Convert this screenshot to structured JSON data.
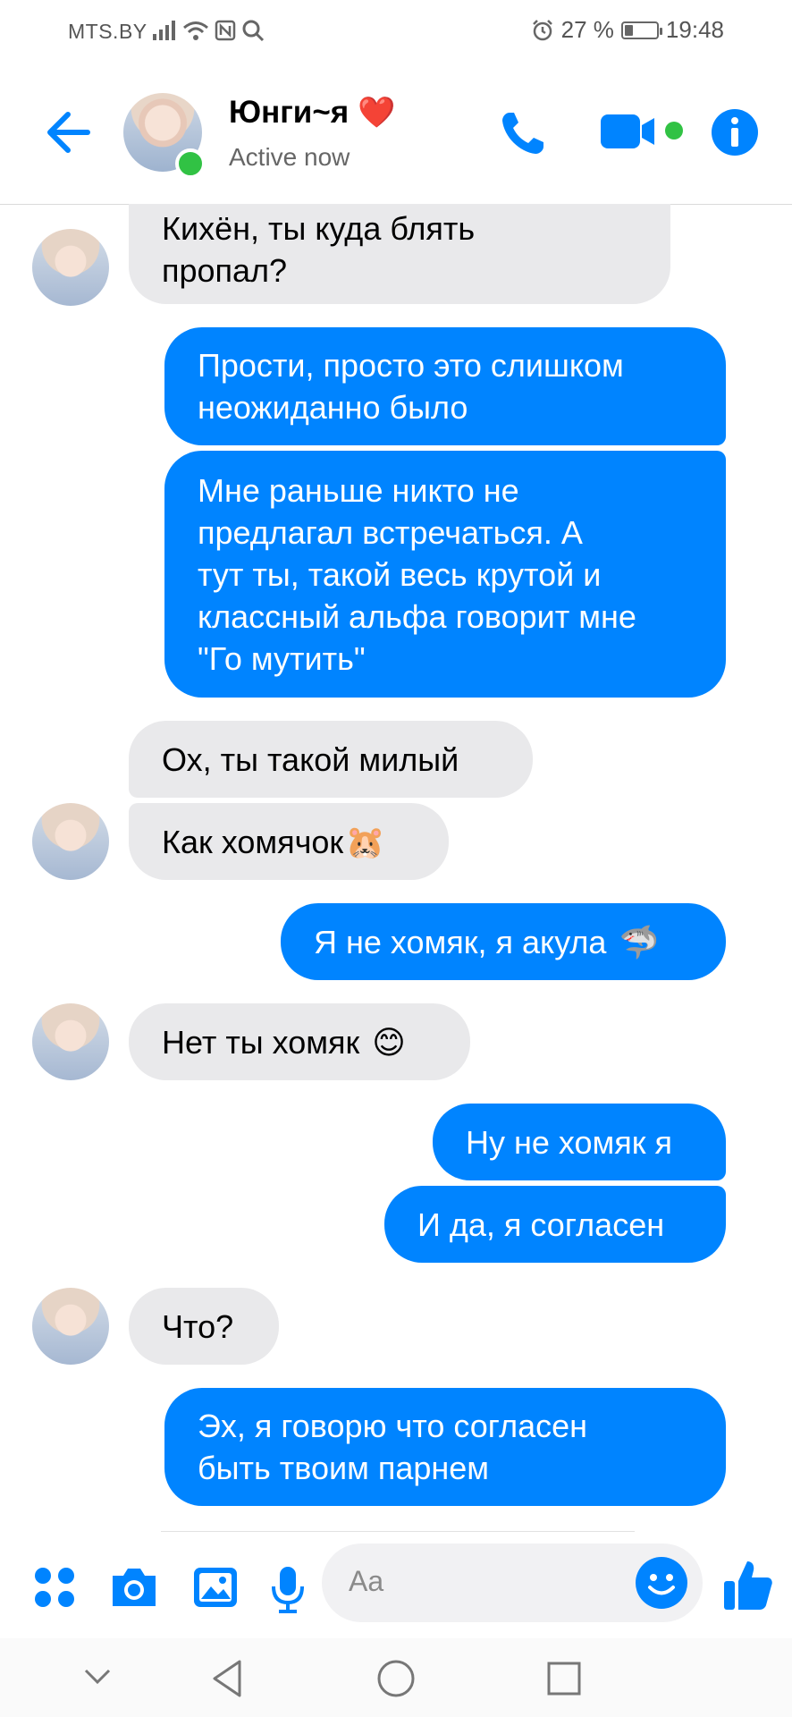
{
  "status_bar": {
    "carrier": "MTS.BY",
    "battery_percent": "27 %",
    "time": "19:48",
    "battery_level": 0.27
  },
  "header": {
    "contact_name": "Юнги~я",
    "heart_emoji": "❤️",
    "presence": "Active now"
  },
  "messages": [
    {
      "side": "incoming",
      "text_lines": [
        "Кихён, ты куда блять",
        "пропал?"
      ]
    },
    {
      "side": "outgoing",
      "text_lines": [
        "Прости, просто это слишком",
        "неожиданно было"
      ]
    },
    {
      "side": "outgoing",
      "text_lines": [
        "Мне раньше никто не",
        "предлагал встречаться. А",
        "тут ты, такой весь крутой и",
        "классный альфа говорит мне",
        "\"Го мутить\""
      ]
    },
    {
      "side": "incoming",
      "text_lines": [
        "Ох, ты такой милый"
      ]
    },
    {
      "side": "incoming",
      "text": "Как хомячок",
      "emoji": "🐹"
    },
    {
      "side": "outgoing",
      "text": "Я не хомяк, я акула",
      "emoji": "🦈"
    },
    {
      "side": "incoming",
      "text": "Нет ты хомяк",
      "emoji": "😊"
    },
    {
      "side": "outgoing",
      "text_lines": [
        "Ну не хомяк я"
      ]
    },
    {
      "side": "outgoing",
      "text_lines": [
        "И да, я согласен"
      ]
    },
    {
      "side": "incoming",
      "text_lines": [
        "Что?"
      ]
    },
    {
      "side": "outgoing",
      "text_lines": [
        "Эх, я говорю что согласен",
        "быть твоим парнем"
      ]
    }
  ],
  "composer": {
    "placeholder": "Aa"
  },
  "colors": {
    "accent": "#0084ff",
    "incoming_bubble": "#e9e9eb",
    "online": "#31c244"
  },
  "icons": [
    "back-arrow-icon",
    "phone-icon",
    "video-camera-icon",
    "info-icon",
    "apps-grid-icon",
    "camera-icon",
    "gallery-icon",
    "microphone-icon",
    "emoji-icon",
    "thumbs-up-icon",
    "nav-collapse-icon",
    "nav-back-icon",
    "nav-home-icon",
    "nav-recents-icon"
  ]
}
